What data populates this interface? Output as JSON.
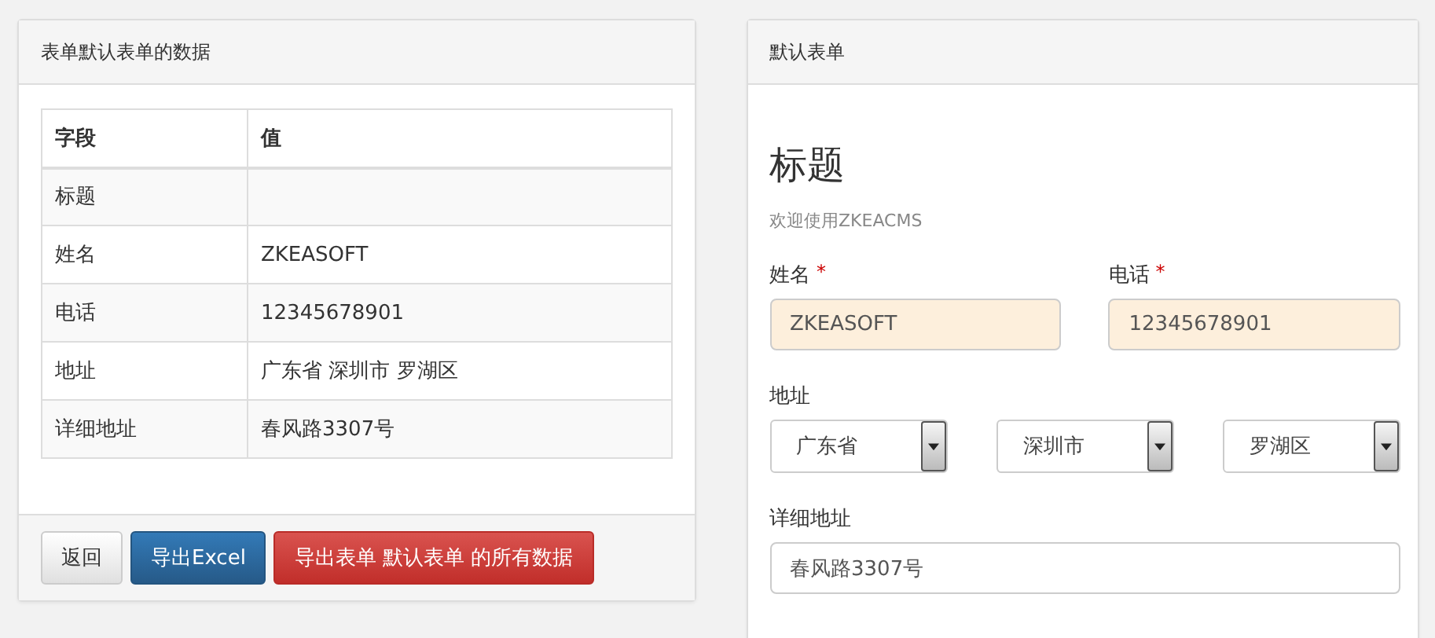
{
  "data_panel": {
    "title": "表单默认表单的数据",
    "table": {
      "columns": [
        "字段",
        "值"
      ],
      "rows": [
        [
          "标题",
          ""
        ],
        [
          "姓名",
          "ZKEASOFT"
        ],
        [
          "电话",
          "12345678901"
        ],
        [
          "地址",
          "广东省 深圳市 罗湖区"
        ],
        [
          "详细地址",
          "春风路3307号"
        ]
      ]
    },
    "buttons": [
      {
        "label": "返回",
        "kind": "default"
      },
      {
        "label": "导出Excel",
        "kind": "primary"
      },
      {
        "label": "导出表单 默认表单 的所有数据",
        "kind": "danger"
      }
    ]
  },
  "form_panel": {
    "title": "默认表单",
    "heading": "标题",
    "subtitle": "欢迎使用ZKEACMS",
    "fields": [
      {
        "label": "姓名",
        "required_mark": "*",
        "value": "ZKEASOFT",
        "highlighted": true
      },
      {
        "label": "电话",
        "required_mark": "*",
        "value": "12345678901",
        "highlighted": true
      }
    ],
    "address": {
      "label": "地址",
      "selects": [
        "广东省",
        "深圳市",
        "罗湖区"
      ]
    },
    "detail": {
      "label": "详细地址",
      "value": "春风路3307号",
      "highlighted": false
    }
  }
}
